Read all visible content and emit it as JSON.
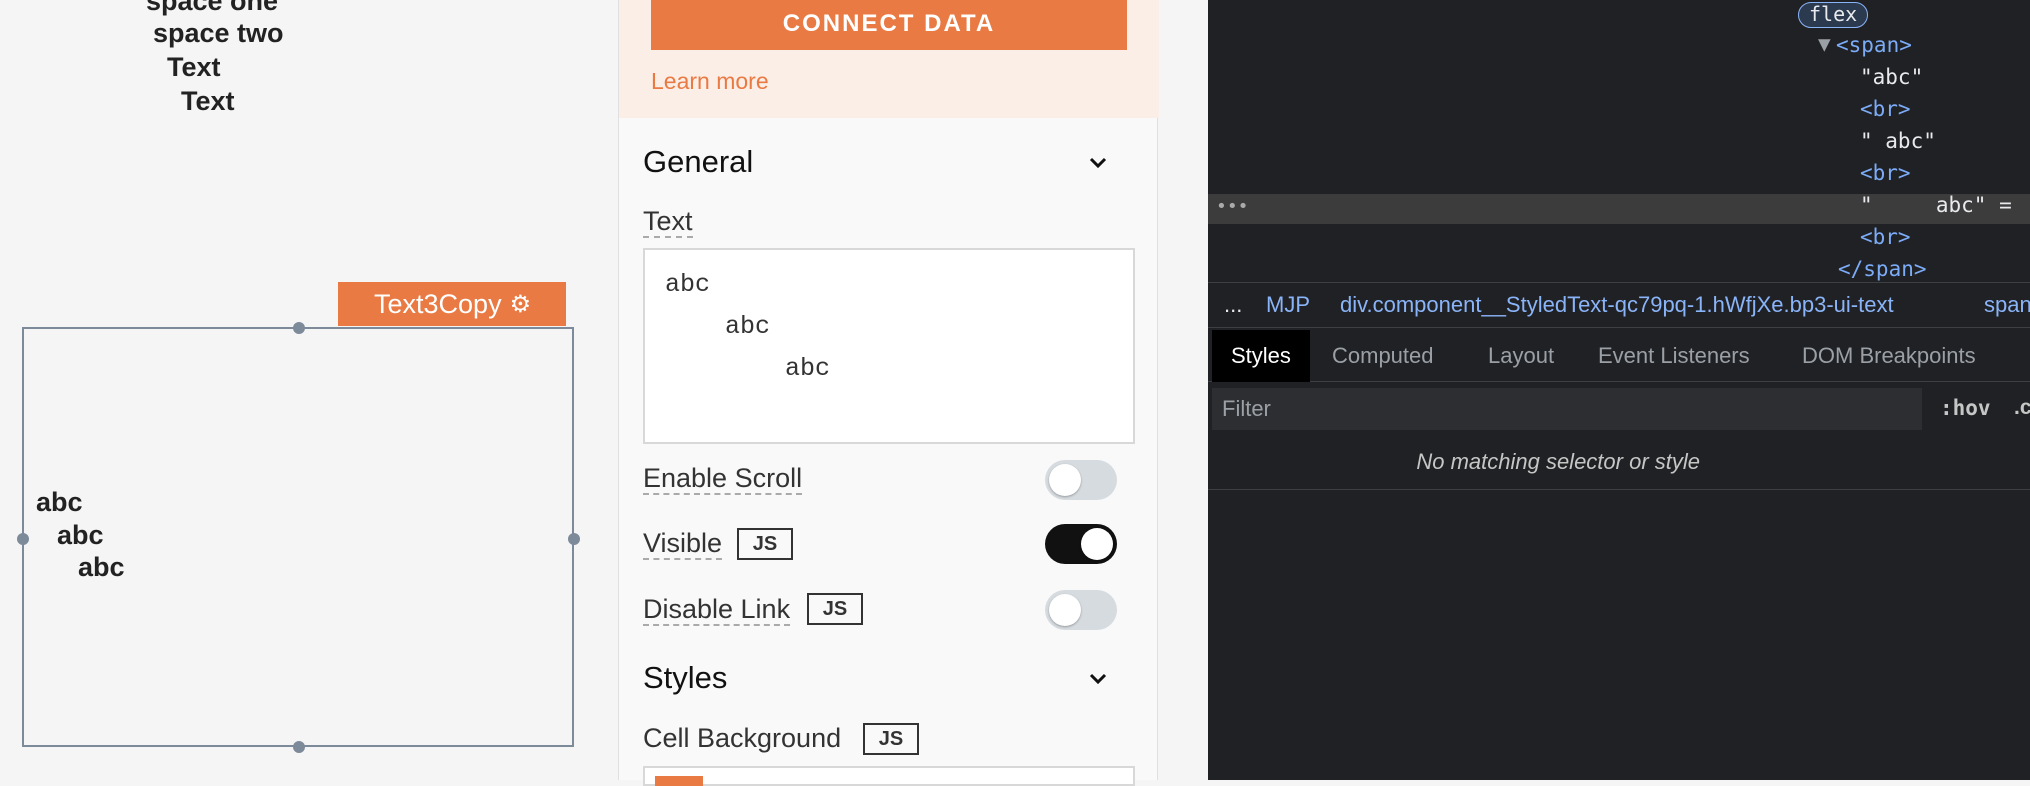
{
  "canvas": {
    "top_lines": [
      "space one",
      "space two",
      "Text",
      "Text"
    ],
    "widget_name": "Text3Copy",
    "widget_lines": [
      "abc",
      "abc",
      "abc"
    ]
  },
  "panel": {
    "connect_label": "CONNECT DATA",
    "learn_more": "Learn more",
    "general_title": "General",
    "text_label": "Text",
    "text_lines": [
      "abc",
      "    abc",
      "        abc"
    ],
    "enable_scroll": {
      "label": "Enable Scroll",
      "on": false
    },
    "visible": {
      "label": "Visible",
      "badge": "JS",
      "on": true
    },
    "disable_link": {
      "label": "Disable Link",
      "badge": "JS",
      "on": false
    },
    "styles_title": "Styles",
    "cell_background": {
      "label": "Cell Background",
      "badge": "JS"
    }
  },
  "devtools": {
    "flex_badge": "flex",
    "dom_lines": [
      {
        "text": "<span>",
        "kind": "tag"
      },
      {
        "text": "\"abc\"",
        "kind": "str"
      },
      {
        "text": "<br>",
        "kind": "tag"
      },
      {
        "text": "\" abc\"",
        "kind": "str"
      },
      {
        "text": "<br>",
        "kind": "tag"
      },
      {
        "text": "\"     abc\" =",
        "kind": "str"
      },
      {
        "text": "<br>",
        "kind": "tag"
      },
      {
        "text": "</span>",
        "kind": "tag"
      }
    ],
    "breadcrumb": [
      "...",
      "MJP",
      "div.component__StyledText-qc79pq-1.hWfjXe.bp3-ui-text",
      "span"
    ],
    "tabs": [
      "Styles",
      "Computed",
      "Layout",
      "Event Listeners",
      "DOM Breakpoints"
    ],
    "filter_placeholder": "Filter",
    "hov_label": ":hov",
    "cls_label": ".cls",
    "no_match": "No matching selector or style"
  },
  "colors": {
    "accent": "#e97a43",
    "devtools_bg": "#202124",
    "tag": "#7cacf8"
  }
}
